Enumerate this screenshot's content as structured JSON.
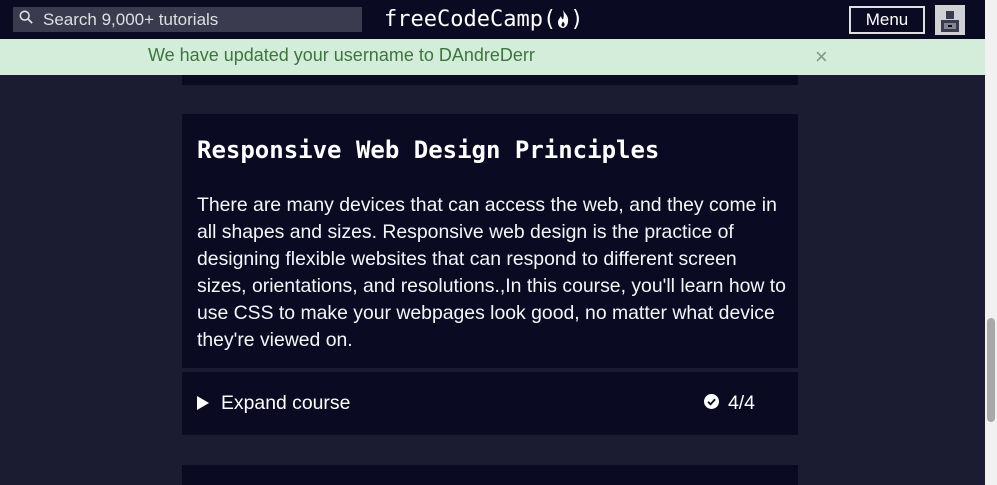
{
  "navbar": {
    "search_placeholder": "Search 9,000+ tutorials",
    "logo_text": "freeCodeCamp(",
    "logo_close": ")",
    "menu_label": "Menu"
  },
  "flash": {
    "message": "We have updated your username to DAndreDerr",
    "close_glyph": "×"
  },
  "course": {
    "title": "Responsive Web Design Principles",
    "description": "There are many devices that can access the web, and they come in all shapes and sizes. Responsive web design is the practice of designing flexible websites that can respond to different screen sizes, orientations, and resolutions.,In this course, you'll learn how to use CSS to make your webpages look good, no matter what device they're viewed on.",
    "expand_label": "Expand course",
    "progress": "4/4"
  },
  "colors": {
    "page_bg": "#1b1b32",
    "navbar_bg": "#0a0a23",
    "card_bg": "#0a0a23",
    "flash_bg": "#d4edda",
    "flash_text": "#3c763d"
  },
  "icons": {
    "search": "search-icon",
    "flame": "flame-icon",
    "avatar": "avatar-icon",
    "close": "close-icon",
    "expand": "caret-right-icon",
    "check": "check-circle-icon"
  }
}
